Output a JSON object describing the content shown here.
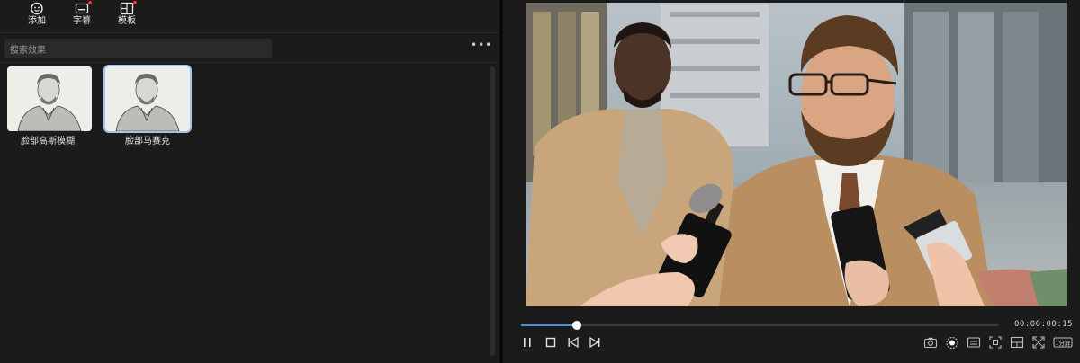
{
  "toolbar": {
    "items": [
      {
        "label": "添加",
        "icon": "sticker-add-icon",
        "badge": false
      },
      {
        "label": "字幕",
        "icon": "subtitle-icon",
        "badge": true
      },
      {
        "label": "模板",
        "icon": "template-icon",
        "badge": true
      }
    ]
  },
  "search": {
    "placeholder": "搜索效果"
  },
  "effects": [
    {
      "label": "脸部高斯模糊",
      "selected": false
    },
    {
      "label": "脸部马赛克",
      "selected": true
    }
  ],
  "player": {
    "timecode": "00:00:00:15",
    "progress_fraction": 0.117,
    "controls": [
      "pause-icon",
      "stop-icon",
      "previous-frame-icon",
      "next-frame-icon"
    ],
    "right_tools": [
      "snapshot-icon",
      "audio-icon",
      "subtitle-toggle-icon",
      "crop-icon",
      "layout-icon",
      "fullscreen-icon",
      "resolution-icon"
    ],
    "resolution_label": "1分屏"
  },
  "colors": {
    "accent": "#4a90e2",
    "badge": "#e0393e"
  }
}
